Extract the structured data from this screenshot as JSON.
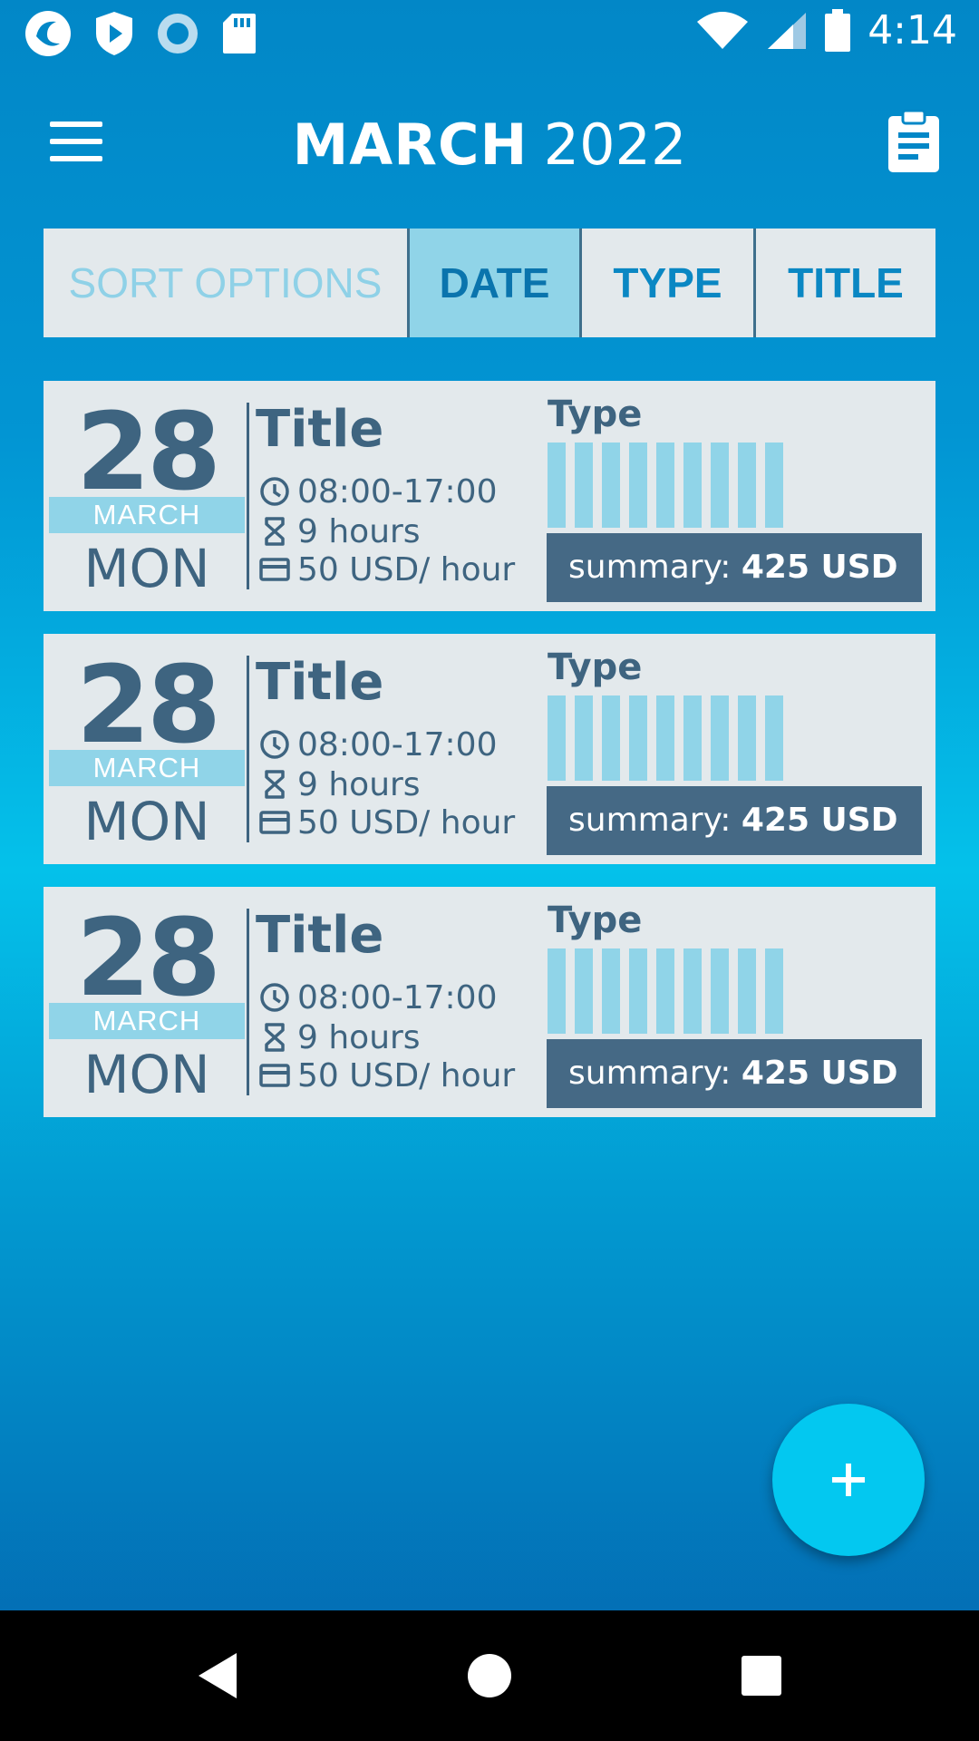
{
  "status_bar": {
    "time": "4:14",
    "icons": [
      "app-logo-icon",
      "play-shield-icon",
      "record-icon",
      "sd-card-icon",
      "wifi-icon",
      "signal-icon",
      "battery-icon"
    ]
  },
  "header": {
    "month": "MARCH",
    "year": "2022",
    "menu_icon": "hamburger-menu-icon",
    "action_icon": "clipboard-icon"
  },
  "sort": {
    "label": "SORT OPTIONS",
    "options": [
      {
        "label": "DATE",
        "selected": true
      },
      {
        "label": "TYPE",
        "selected": false
      },
      {
        "label": "TITLE",
        "selected": false
      }
    ]
  },
  "entries": [
    {
      "day": "28",
      "month": "MARCH",
      "weekday": "MON",
      "title": "Title",
      "time": "08:00-17:00",
      "duration": "9 hours",
      "rate": "50 USD/ hour",
      "type_label": "Type",
      "type_bar_count": 9,
      "summary_prefix": "summary:",
      "summary_value": "425 USD"
    },
    {
      "day": "28",
      "month": "MARCH",
      "weekday": "MON",
      "title": "Title",
      "time": "08:00-17:00",
      "duration": "9 hours",
      "rate": "50 USD/ hour",
      "type_label": "Type",
      "type_bar_count": 9,
      "summary_prefix": "summary:",
      "summary_value": "425 USD"
    },
    {
      "day": "28",
      "month": "MARCH",
      "weekday": "MON",
      "title": "Title",
      "time": "08:00-17:00",
      "duration": "9 hours",
      "rate": "50 USD/ hour",
      "type_label": "Type",
      "type_bar_count": 9,
      "summary_prefix": "summary:",
      "summary_value": "425 USD"
    }
  ],
  "colors": {
    "card_bg": "#e3e9ec",
    "accent_light": "#90d4e8",
    "text_dark": "#3e6480",
    "summary_bg": "#456985",
    "fab": "#03c8f0"
  }
}
